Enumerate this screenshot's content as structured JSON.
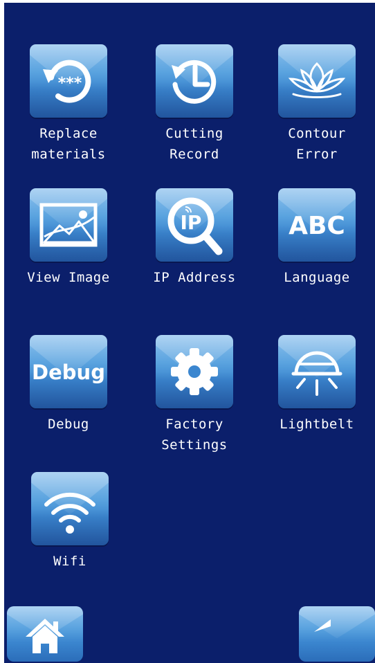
{
  "tiles": [
    {
      "label": "Replace\nmaterials",
      "icon": "reset-password-icon",
      "glyph": "***"
    },
    {
      "label": "Cutting\nRecord",
      "icon": "history-clock-icon"
    },
    {
      "label": "Contour\nError",
      "icon": "lotus-icon"
    },
    {
      "label": "View Image",
      "icon": "image-icon"
    },
    {
      "label": "IP Address",
      "icon": "ip-search-icon",
      "glyph": "IP"
    },
    {
      "label": "Language",
      "icon": "language-icon",
      "glyph": "ABC"
    },
    {
      "label": "Debug",
      "icon": "debug-icon",
      "glyph": "Debug"
    },
    {
      "label": "Factory\nSettings",
      "icon": "gear-icon"
    },
    {
      "label": "Lightbelt",
      "icon": "lamp-icon"
    },
    {
      "label": "Wifi",
      "icon": "wifi-icon"
    }
  ],
  "nav": {
    "home_icon": "home-icon",
    "back_icon": "back-arrow-icon"
  },
  "colors": {
    "background": "#0b1f6b",
    "tile_top": "#8ec2ee",
    "tile_bottom": "#2b6db9",
    "text": "#ffffff"
  }
}
